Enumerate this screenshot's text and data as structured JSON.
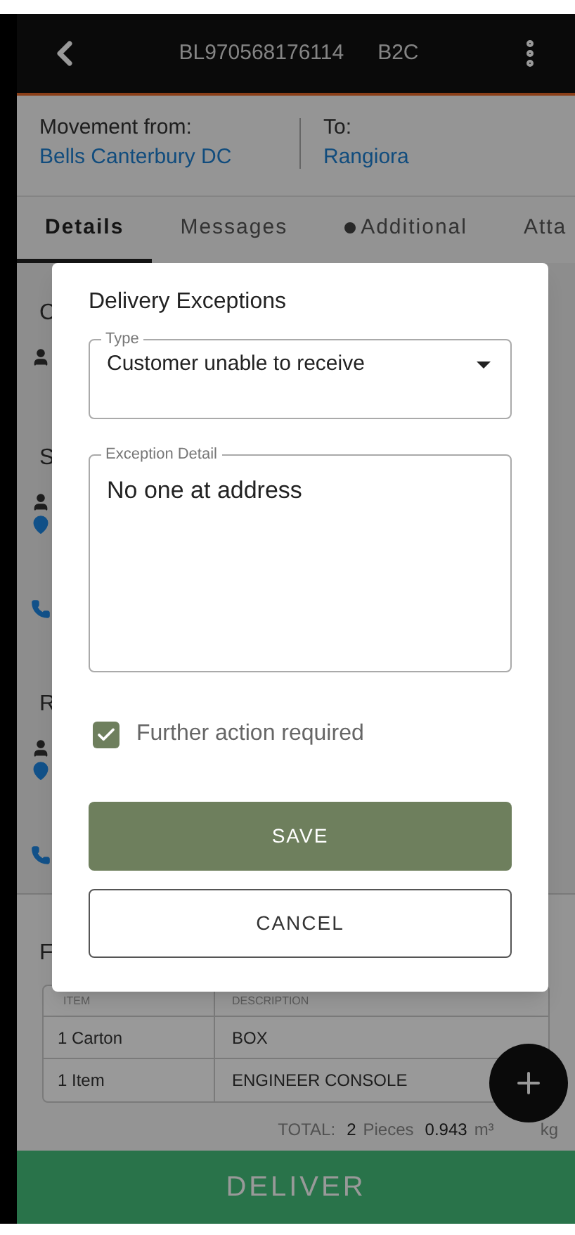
{
  "header": {
    "title": "BL970568176114",
    "type": "B2C"
  },
  "route": {
    "from_label": "Movement from:",
    "from": "Bells Canterbury DC",
    "to_label": "To:",
    "to": "Rangiora"
  },
  "tabs": [
    {
      "label": "Details",
      "selected": true,
      "dot": false
    },
    {
      "label": "Messages",
      "selected": false,
      "dot": false
    },
    {
      "label": "Additional",
      "selected": false,
      "dot": true
    },
    {
      "label": "Atta",
      "selected": false,
      "dot": false
    }
  ],
  "sections": [
    {
      "title": "C",
      "kind": "contact"
    },
    {
      "title": "S",
      "kind": "party"
    },
    {
      "title": "R",
      "kind": "party"
    }
  ],
  "freight": {
    "title": "F",
    "columns": [
      "ITEM",
      "DESCRIPTION"
    ],
    "rows": [
      [
        "1 Carton",
        "BOX"
      ],
      [
        "1 Item",
        "ENGINEER CONSOLE"
      ]
    ],
    "total": {
      "label": "TOTAL:",
      "pieces": "2",
      "pieces_unit": "Pieces",
      "volume": "0.943",
      "volume_unit": "m³",
      "weight_unit": "kg"
    }
  },
  "deliver_button": "DELIVER",
  "dialog": {
    "title": "Delivery Exceptions",
    "type_field": {
      "label": "Type",
      "value": "Customer unable to receive"
    },
    "detail_field": {
      "label": "Exception Detail",
      "value": "No one at address"
    },
    "further_action": {
      "label": "Further action required",
      "checked": true
    },
    "save": "SAVE",
    "cancel": "CANCEL"
  }
}
